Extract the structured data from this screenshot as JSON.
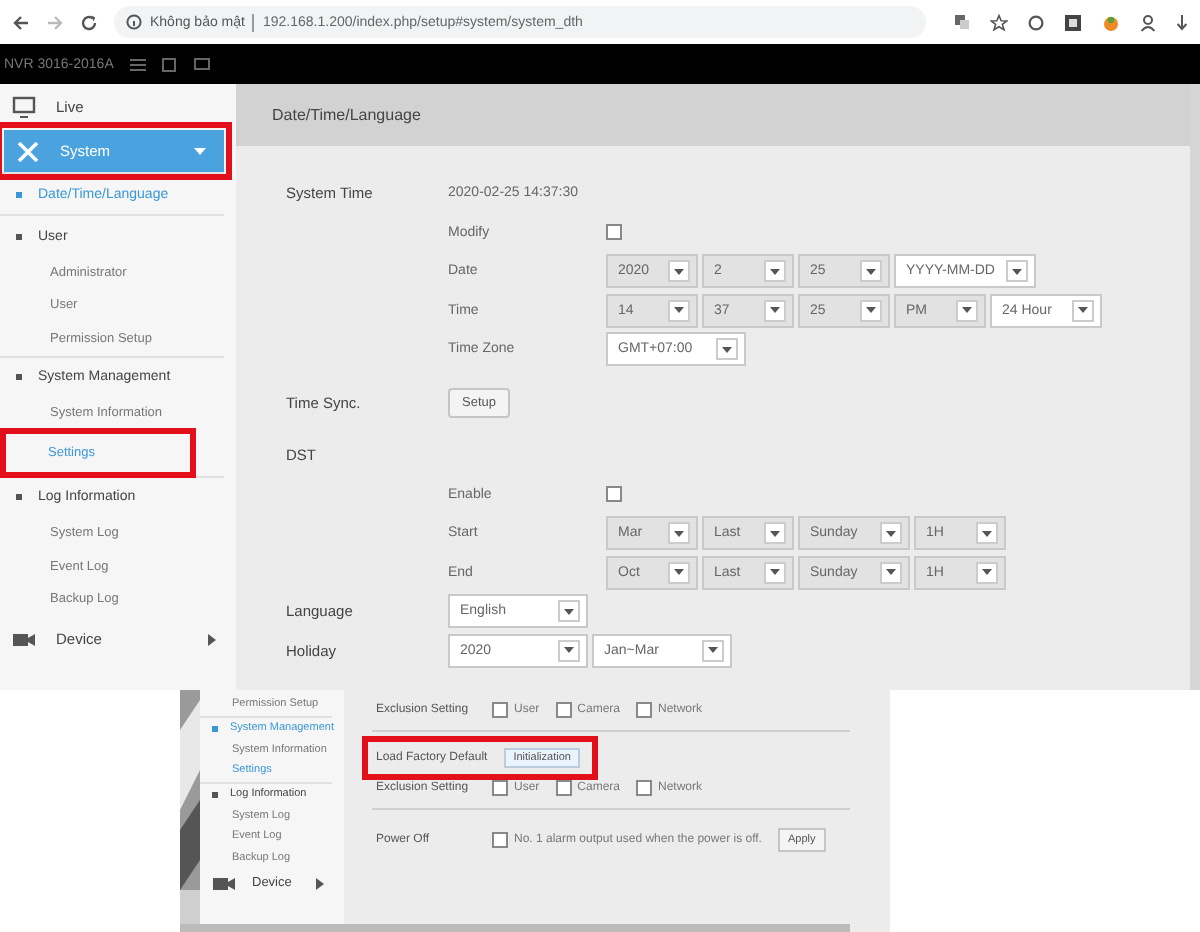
{
  "browser": {
    "security_label": "Không bảo mật",
    "url": "192.168.1.200/index.php/setup#system/system_dth"
  },
  "header": {
    "device_name": "NVR 3016-2016A"
  },
  "sidebar": {
    "items": [
      {
        "kind": "menu",
        "label": "Live",
        "selected": false,
        "highlighted": false
      },
      {
        "kind": "menu",
        "label": "System",
        "selected": true,
        "highlighted": true,
        "children": [
          {
            "kind": "group",
            "label": "Date/Time/Language",
            "selected": true,
            "highlighted": false
          },
          {
            "kind": "group",
            "label": "User",
            "selected": false,
            "highlighted": false,
            "children": [
              {
                "kind": "link",
                "label": "Administrator",
                "selected": false,
                "highlighted": false
              },
              {
                "kind": "link",
                "label": "User",
                "selected": false,
                "highlighted": false
              },
              {
                "kind": "link",
                "label": "Permission Setup",
                "selected": false,
                "highlighted": false
              }
            ]
          },
          {
            "kind": "group",
            "label": "System Management",
            "selected": false,
            "highlighted": false,
            "children": [
              {
                "kind": "link",
                "label": "System Information",
                "selected": false,
                "highlighted": false
              },
              {
                "kind": "link",
                "label": "Settings",
                "selected": true,
                "highlighted": true
              }
            ]
          },
          {
            "kind": "group",
            "label": "Log Information",
            "selected": false,
            "highlighted": false,
            "children": [
              {
                "kind": "link",
                "label": "System Log",
                "selected": false,
                "highlighted": false
              },
              {
                "kind": "link",
                "label": "Event Log",
                "selected": false,
                "highlighted": false
              },
              {
                "kind": "link",
                "label": "Backup Log",
                "selected": false,
                "highlighted": false
              }
            ]
          }
        ]
      },
      {
        "kind": "menu",
        "label": "Device",
        "selected": false,
        "highlighted": false
      }
    ]
  },
  "page": {
    "title": "Date/Time/Language",
    "sections": [
      {
        "label": "System Time",
        "value": "2020-02-25 14:37:30",
        "fields": [
          {
            "kind": "checkbox",
            "label": "Modify",
            "checked": false
          },
          {
            "kind": "selects",
            "label": "Date",
            "selects": [
              {
                "value": "2020",
                "disabled": true
              },
              {
                "value": "2",
                "disabled": true
              },
              {
                "value": "25",
                "disabled": true
              },
              {
                "value": "YYYY-MM-DD",
                "disabled": false
              }
            ]
          },
          {
            "kind": "selects",
            "label": "Time",
            "selects": [
              {
                "value": "14",
                "disabled": true
              },
              {
                "value": "37",
                "disabled": true
              },
              {
                "value": "25",
                "disabled": true
              },
              {
                "value": "PM",
                "disabled": true
              },
              {
                "value": "24 Hour",
                "disabled": false
              }
            ]
          },
          {
            "kind": "selects",
            "label": "Time Zone",
            "selects": [
              {
                "value": "GMT+07:00",
                "disabled": false
              }
            ]
          }
        ]
      },
      {
        "label": "Time Sync.",
        "button": "Setup"
      },
      {
        "label": "DST",
        "fields": [
          {
            "kind": "checkbox",
            "label": "Enable",
            "checked": false
          },
          {
            "kind": "selects",
            "label": "Start",
            "selects": [
              {
                "value": "Mar",
                "disabled": true
              },
              {
                "value": "Last",
                "disabled": true
              },
              {
                "value": "Sunday",
                "disabled": true
              },
              {
                "value": "1H",
                "disabled": true
              }
            ]
          },
          {
            "kind": "selects",
            "label": "End",
            "selects": [
              {
                "value": "Oct",
                "disabled": true
              },
              {
                "value": "Last",
                "disabled": true
              },
              {
                "value": "Sunday",
                "disabled": true
              },
              {
                "value": "1H",
                "disabled": true
              }
            ]
          }
        ]
      },
      {
        "label": "Language",
        "selects": [
          {
            "value": "English",
            "disabled": false
          }
        ]
      },
      {
        "label": "Holiday",
        "selects": [
          {
            "value": "2020",
            "disabled": false
          },
          {
            "value": "Jan~Mar",
            "disabled": false
          }
        ]
      }
    ]
  },
  "inset": {
    "sidebar": {
      "items": [
        {
          "kind": "link",
          "label": "Permission Setup",
          "selected": false,
          "highlighted": false
        },
        {
          "kind": "group",
          "label": "System Management",
          "selected": true,
          "highlighted": false,
          "children": [
            {
              "kind": "link",
              "label": "System Information",
              "selected": false,
              "highlighted": false
            },
            {
              "kind": "link",
              "label": "Settings",
              "selected": true,
              "highlighted": false
            }
          ]
        },
        {
          "kind": "group",
          "label": "Log Information",
          "selected": false,
          "highlighted": false,
          "children": [
            {
              "kind": "link",
              "label": "System Log",
              "selected": false,
              "highlighted": false
            },
            {
              "kind": "link",
              "label": "Event Log",
              "selected": false,
              "highlighted": false
            },
            {
              "kind": "link",
              "label": "Backup Log",
              "selected": false,
              "highlighted": false
            }
          ]
        },
        {
          "kind": "menu",
          "label": "Device",
          "selected": false,
          "highlighted": false
        }
      ]
    },
    "rows": [
      {
        "kind": "options",
        "label": "Exclusion Setting",
        "highlighted": false,
        "options": [
          {
            "label": "User",
            "checked": false
          },
          {
            "label": "Camera",
            "checked": false
          },
          {
            "label": "Network",
            "checked": false
          }
        ]
      },
      {
        "kind": "divider"
      },
      {
        "kind": "button",
        "label": "Load Factory Default",
        "button": "Initialization",
        "highlighted": true
      },
      {
        "kind": "options",
        "label": "Exclusion Setting",
        "highlighted": false,
        "options": [
          {
            "label": "User",
            "checked": false
          },
          {
            "label": "Camera",
            "checked": false
          },
          {
            "label": "Network",
            "checked": false
          }
        ]
      },
      {
        "kind": "divider"
      },
      {
        "kind": "apply",
        "label": "Power Off",
        "highlighted": false,
        "checkbox_label": "No. 1 alarm output used when the power is off.",
        "checked": false,
        "button": "Apply"
      }
    ]
  }
}
